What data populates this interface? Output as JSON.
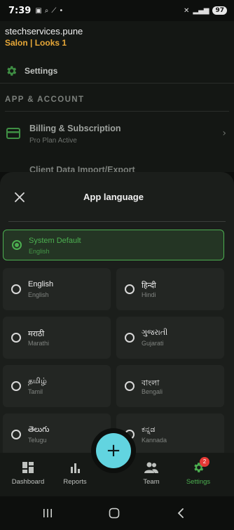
{
  "status_bar": {
    "time": "7:39",
    "battery": "97"
  },
  "background": {
    "business_name": "stechservices.pune",
    "business_sub": "Salon | Looks 1",
    "settings_title": "Settings",
    "section_heading": "APP & ACCOUNT",
    "billing_title": "Billing & Subscription",
    "billing_sub": "Pro Plan Active",
    "import_peek": "Client Data Import/Export"
  },
  "sheet": {
    "title": "App language",
    "default_option": {
      "name": "System Default",
      "sub": "English",
      "selected": true
    },
    "languages": [
      {
        "name": "English",
        "sub": "English"
      },
      {
        "name": "हिन्दी",
        "sub": "Hindi"
      },
      {
        "name": "मराठी",
        "sub": "Marathi"
      },
      {
        "name": "ગુજરાતી",
        "sub": "Gujarati"
      },
      {
        "name": "தமிழ்",
        "sub": "Tamil"
      },
      {
        "name": "বাংলা",
        "sub": "Bengali"
      },
      {
        "name": "తెలుగు",
        "sub": "Telugu"
      },
      {
        "name": "ಕನ್ನಡ",
        "sub": "Kannada"
      }
    ]
  },
  "bottom_nav": {
    "items": [
      {
        "label": "Dashboard",
        "icon": "dashboard-icon"
      },
      {
        "label": "Reports",
        "icon": "bar-chart-icon"
      },
      {
        "label": "Team",
        "icon": "team-icon"
      },
      {
        "label": "Settings",
        "icon": "gear-icon",
        "badge": "2",
        "active": true
      }
    ],
    "fab_label": "+"
  },
  "colors": {
    "accent_green": "#4caf50",
    "brand_orange": "#e8a838",
    "fab_cyan": "#62d4e0",
    "badge_red": "#e53935"
  }
}
